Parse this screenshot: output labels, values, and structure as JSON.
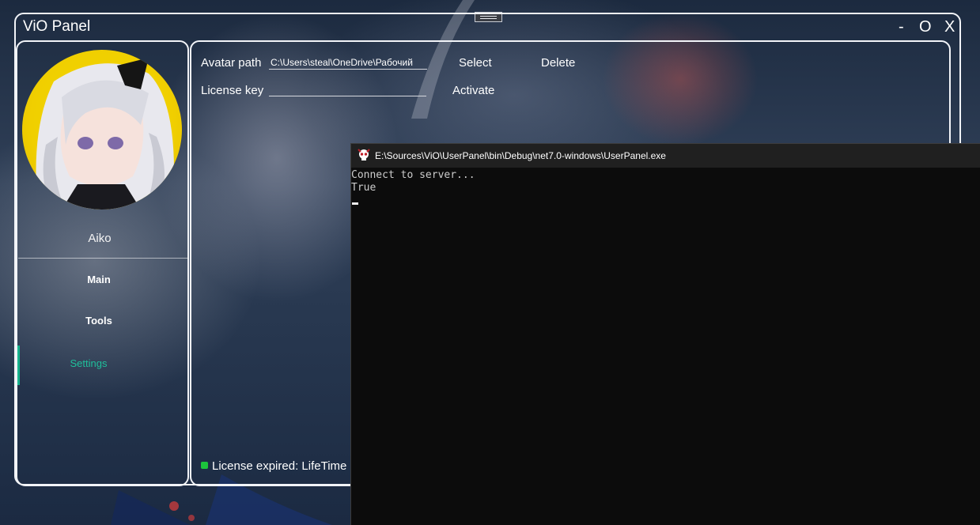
{
  "window": {
    "title": "ViO Panel",
    "minimize_label": "-",
    "maximize_label": "O",
    "close_label": "X"
  },
  "sidebar": {
    "username": "Aiko",
    "items": [
      {
        "label": "Main",
        "active": false
      },
      {
        "label": "Tools",
        "active": false
      },
      {
        "label": "Settings",
        "active": true
      }
    ],
    "active_color": "#1fbf9b"
  },
  "settings": {
    "avatar_path_label": "Avatar path",
    "avatar_path_value": "C:\\Users\\steal\\OneDrive\\Рабочий",
    "select_label": "Select",
    "delete_label": "Delete",
    "license_key_label": "License key",
    "license_key_value": "",
    "activate_label": "Activate",
    "status_text": "License expired: LifeTime",
    "status_color": "#1cc43c"
  },
  "console": {
    "title": "E:\\Sources\\ViO\\UserPanel\\bin\\Debug\\net7.0-windows\\UserPanel.exe",
    "lines": [
      "Connect to server...",
      "True"
    ]
  }
}
